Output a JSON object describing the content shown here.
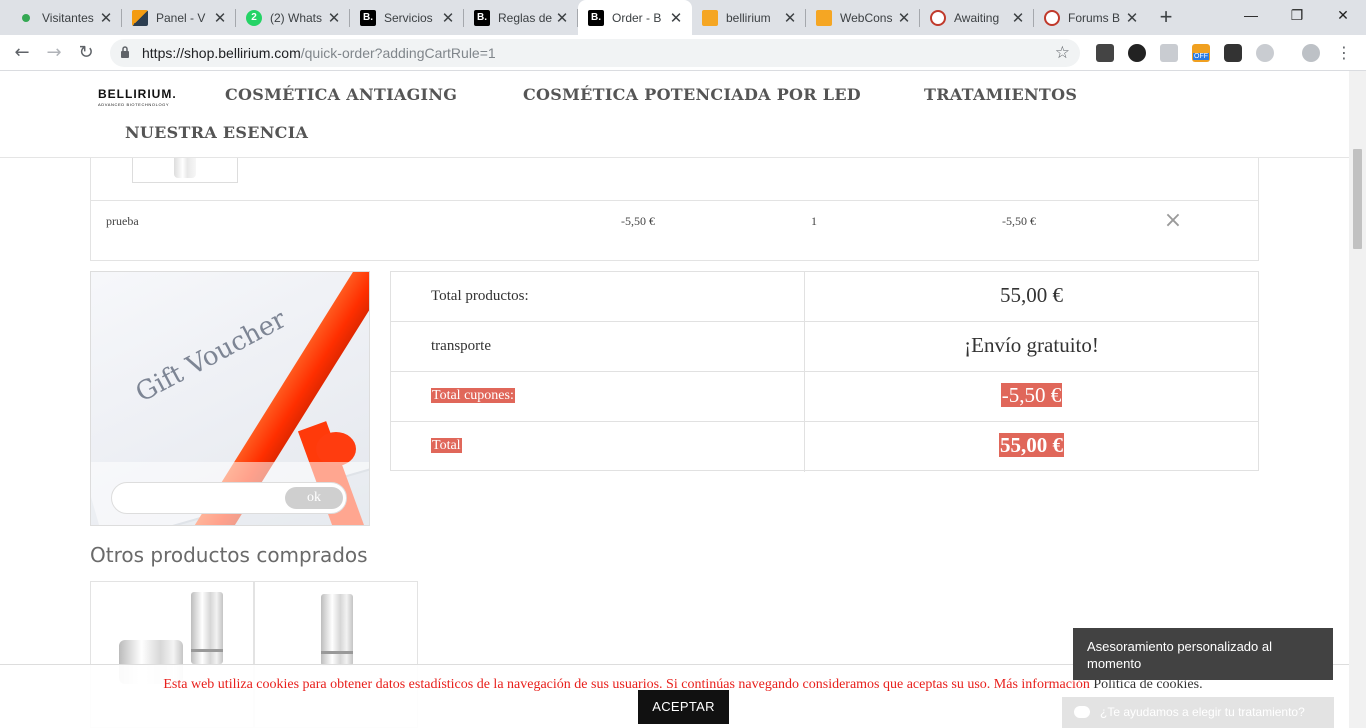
{
  "browser": {
    "tabs": [
      {
        "title": "Visitantes",
        "icon": "green-dot-icon"
      },
      {
        "title": "Panel - V",
        "icon": "panel-icon"
      },
      {
        "title": "(2) Whats",
        "icon": "whatsapp-icon",
        "badge": "2"
      },
      {
        "title": "Servicios",
        "icon": "bellirium-b-icon",
        "badge": "B."
      },
      {
        "title": "Reglas de",
        "icon": "bellirium-b-icon",
        "badge": "B."
      },
      {
        "title": "Order - B",
        "icon": "bellirium-b-icon",
        "badge": "B.",
        "active": true
      },
      {
        "title": "bellirium",
        "icon": "mail-icon"
      },
      {
        "title": "WebCons",
        "icon": "mail-icon"
      },
      {
        "title": "Awaiting",
        "icon": "bird-icon"
      },
      {
        "title": "Forums B",
        "icon": "bird-icon"
      }
    ],
    "new_tab": "+",
    "url_host": "https://shop.bellirium.com",
    "url_path": "/quick-order?addingCartRule=1",
    "window_controls": {
      "minimize": "—",
      "restore": "❐",
      "close": "✕"
    },
    "nav": {
      "back": "←",
      "forward": "→",
      "reload": "↻"
    },
    "ext_off_label": "OFF"
  },
  "site": {
    "logo": "BELLIRIUM.",
    "logo_tagline": "ADVANCED BIOTECHNOLOGY",
    "nav": [
      "COSMÉTICA ANTIAGING",
      "COSMÉTICA POTENCIADA POR LED",
      "TRATAMIENTOS",
      "NUESTRA ESENCIA"
    ]
  },
  "cart_row": {
    "name": "prueba",
    "unit_price": "-5,50 €",
    "quantity": "1",
    "total": "-5,50 €",
    "remove": "×"
  },
  "voucher": {
    "image_text": "Gift Voucher",
    "input_value": "",
    "ok_label": "ok"
  },
  "totals": [
    {
      "label": "Total productos:",
      "value": "55,00 €",
      "highlight": false
    },
    {
      "label": "transporte",
      "value": "¡Envío gratuito!",
      "highlight": false
    },
    {
      "label": "Total cupones:",
      "value": "-5,50 €",
      "highlight": true
    },
    {
      "label": "Total",
      "value": "55,00 €",
      "highlight": true
    }
  ],
  "other_products_title": "Otros productos comprados",
  "cookie": {
    "message": "Esta web utiliza cookies para obtener datos estadísticos de la navegación de sus usuarios. Si continúas navegando consideramos que aceptas su uso. Más información",
    "link": "Política de cookies.",
    "button": "ACEPTAR"
  },
  "chat": {
    "box_text": "Asesoramiento personalizado al momento",
    "tab_text": "¿Te ayudamos a elegir tu tratamiento?"
  },
  "colors": {
    "highlight": "#e0675a",
    "cookie_text": "#e8201c",
    "tabstrip": "#dee1e6"
  }
}
